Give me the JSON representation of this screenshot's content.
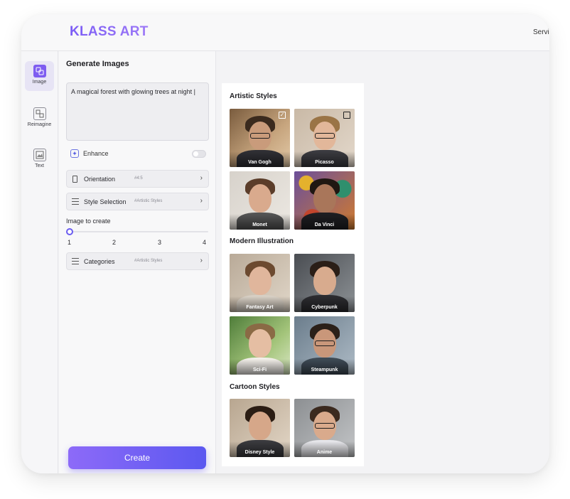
{
  "app": {
    "brand": "KLASS ART",
    "top_link": "Servic"
  },
  "rail": {
    "items": [
      {
        "label": "Image",
        "icon": "image-generate-icon",
        "active": true
      },
      {
        "label": "Reimagine",
        "icon": "reimagine-icon",
        "active": false
      },
      {
        "label": "Text",
        "icon": "text-image-icon",
        "active": false
      }
    ]
  },
  "panel": {
    "title": "Generate Images",
    "prompt_value": "A magical forest with glowing trees at night |",
    "enhance_label": "Enhance",
    "enhance_enabled": false,
    "orientation": {
      "label": "Orientation",
      "tag": "#4:5"
    },
    "style_selection": {
      "label": "Style Selection",
      "tag": "#Artistic Styles"
    },
    "image_count": {
      "label": "Image to create",
      "ticks": [
        "1",
        "2",
        "3",
        "4"
      ],
      "value": 1
    },
    "categories": {
      "label": "Categories",
      "tag": "#Artistic Styles"
    },
    "create_label": "Create"
  },
  "styles": {
    "sections": [
      {
        "title": "Artistic Styles",
        "cards": [
          {
            "label": "Van Gogh",
            "checked": true
          },
          {
            "label": "Picasso",
            "checked": false
          },
          {
            "label": "Monet"
          },
          {
            "label": "Da Vinci"
          }
        ]
      },
      {
        "title": "Modern Illustration",
        "cards": [
          {
            "label": "Fantasy Art"
          },
          {
            "label": "Cyberpunk"
          },
          {
            "label": "Sci-Fi"
          },
          {
            "label": "Steampunk"
          }
        ]
      },
      {
        "title": "Cartoon Styles",
        "cards": [
          {
            "label": "Disney Style"
          },
          {
            "label": "Anime"
          }
        ]
      }
    ]
  },
  "colors": {
    "accent": "#7b5cf5",
    "create_gradient_start": "#8d6af8",
    "create_gradient_end": "#5b58f0"
  }
}
